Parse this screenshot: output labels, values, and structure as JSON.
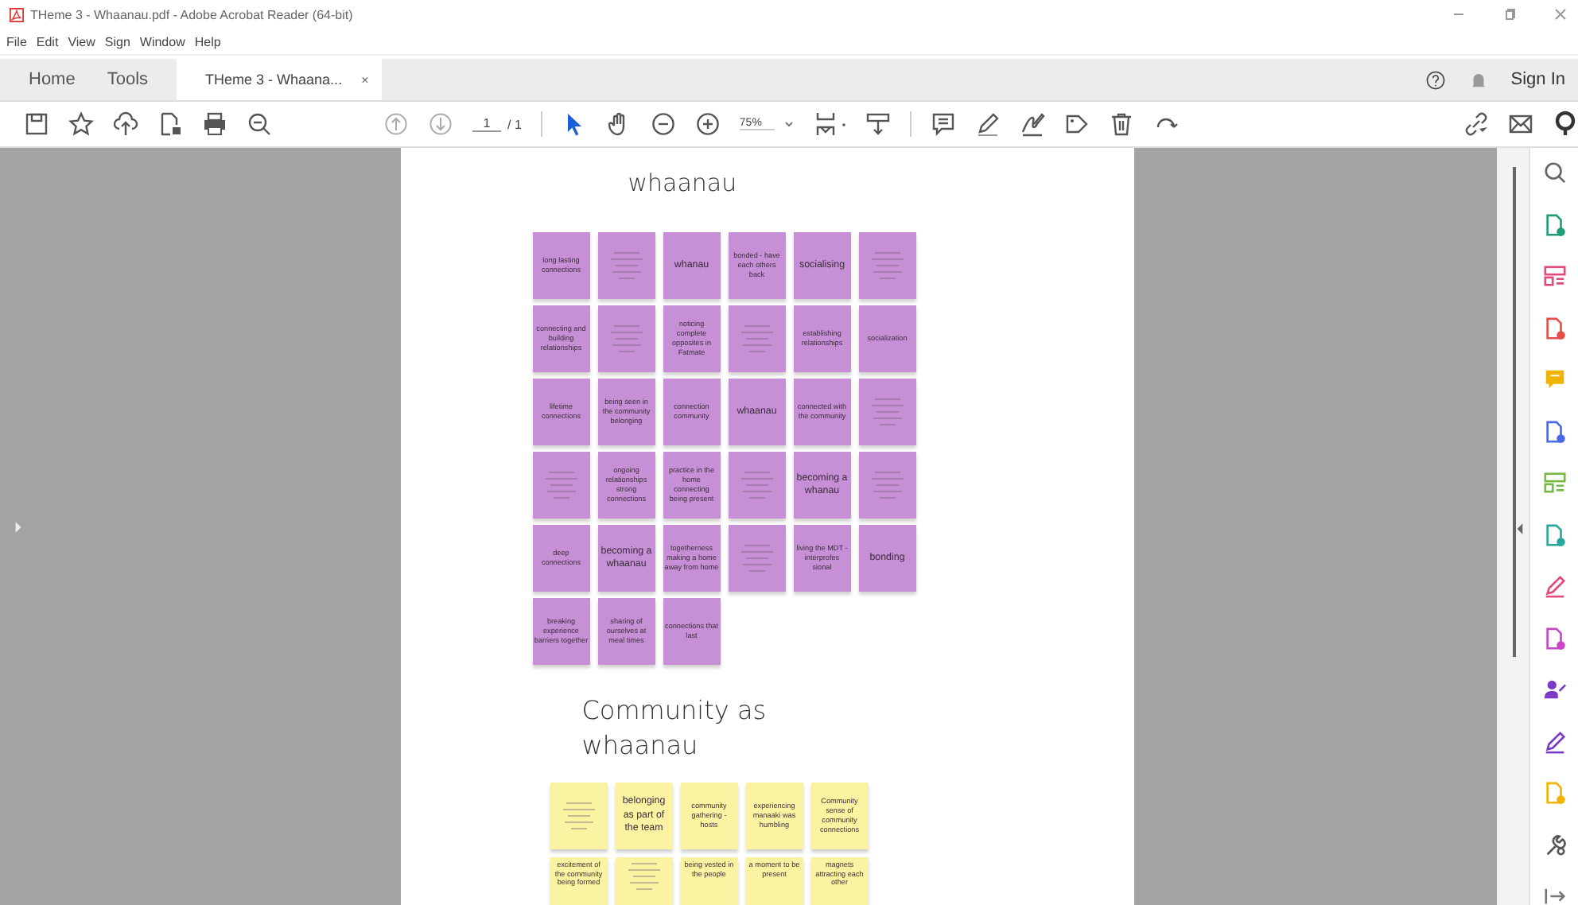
{
  "window": {
    "title": "THeme 3 - Whaanau.pdf - Adobe Acrobat Reader (64-bit)"
  },
  "menu": [
    "File",
    "Edit",
    "View",
    "Sign",
    "Window",
    "Help"
  ],
  "tabs": [
    {
      "label": "Home",
      "selected": false
    },
    {
      "label": "Tools",
      "selected": false
    },
    {
      "label": "THeme 3 - Whaana...",
      "selected": true,
      "close": "×"
    }
  ],
  "account": {
    "sign_in": "Sign In"
  },
  "toolbar": {
    "page_number": "1",
    "page_total": "/ 1",
    "zoom": "75%"
  },
  "sections": [
    {
      "title": "whaanau",
      "color": "#c68fd6",
      "notes": [
        {
          "kind": "text",
          "text": "long lasting connections"
        },
        {
          "kind": "illegible"
        },
        {
          "kind": "big",
          "text": "whanau"
        },
        {
          "kind": "text",
          "text": "bonded - have each others back"
        },
        {
          "kind": "big",
          "text": "socialising"
        },
        {
          "kind": "illegible"
        },
        {
          "kind": "text",
          "text": "connecting and building relationships"
        },
        {
          "kind": "illegible"
        },
        {
          "kind": "text",
          "text": "noticing complete opposites in Fatmate"
        },
        {
          "kind": "illegible"
        },
        {
          "kind": "text",
          "text": "establishing relationships"
        },
        {
          "kind": "text",
          "text": "socialization"
        },
        {
          "kind": "text",
          "text": "lifetime connections"
        },
        {
          "kind": "text",
          "text": "being seen in the community belonging"
        },
        {
          "kind": "text",
          "text": "connection community"
        },
        {
          "kind": "big",
          "text": "whaanau"
        },
        {
          "kind": "text",
          "text": "connected with the community"
        },
        {
          "kind": "illegible"
        },
        {
          "kind": "illegible"
        },
        {
          "kind": "text",
          "text": "ongoing relationships strong connections"
        },
        {
          "kind": "text",
          "text": "practice in the home connecting being present"
        },
        {
          "kind": "illegible"
        },
        {
          "kind": "big",
          "text": "becoming a whanau"
        },
        {
          "kind": "illegible"
        },
        {
          "kind": "text",
          "text": "deep connections"
        },
        {
          "kind": "big",
          "text": "becoming a whaanau"
        },
        {
          "kind": "text",
          "text": "togetherness making a home away from home"
        },
        {
          "kind": "illegible"
        },
        {
          "kind": "text",
          "text": "living the MDT - interprofes sional"
        },
        {
          "kind": "big",
          "text": "bonding"
        },
        {
          "kind": "text",
          "text": "breaking experience barriers together"
        },
        {
          "kind": "text",
          "text": "sharing of ourselves at meal times"
        },
        {
          "kind": "text",
          "text": "connections that last"
        }
      ]
    },
    {
      "title": "Community as whaanau",
      "color": "#faf3a2",
      "notes": [
        {
          "kind": "illegible"
        },
        {
          "kind": "big",
          "text": "belonging as part of the team"
        },
        {
          "kind": "text",
          "text": "community gathering - hosts"
        },
        {
          "kind": "text",
          "text": "experiencing manaaki was humbling"
        },
        {
          "kind": "text",
          "text": "Community sense of community connections"
        },
        {
          "kind": "text",
          "text": "excitement of the community being formed"
        },
        {
          "kind": "illegible"
        },
        {
          "kind": "text",
          "text": "being vested in the people"
        },
        {
          "kind": "text",
          "text": "a moment to be present"
        },
        {
          "kind": "text",
          "text": "magnets attracting each other"
        }
      ]
    }
  ]
}
